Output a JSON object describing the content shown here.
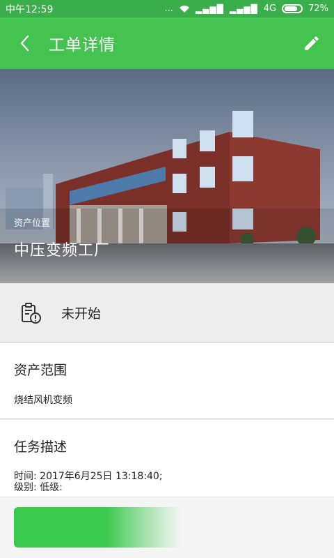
{
  "statusbar": {
    "time": "中午12:59",
    "dots": "...",
    "network": "4G",
    "battery": "72%"
  },
  "header": {
    "title": "工单详情",
    "back_icon": "chevron-left-icon",
    "edit_icon": "pencil-icon"
  },
  "hero": {
    "location_label": "资产位置",
    "location_value": "中压变频工厂"
  },
  "status": {
    "text": "未开始",
    "icon": "clipboard-clock-icon"
  },
  "asset_scope": {
    "title": "资产范围",
    "value": "烧结风机变频"
  },
  "task": {
    "title": "任务描述",
    "time_line": "时间: 2017年6月25日 13:18:40;",
    "level_line": "级别: 低级:"
  },
  "colors": {
    "header": "#44c351",
    "statusbar": "#3aae4a",
    "action": "#3ac94d"
  }
}
